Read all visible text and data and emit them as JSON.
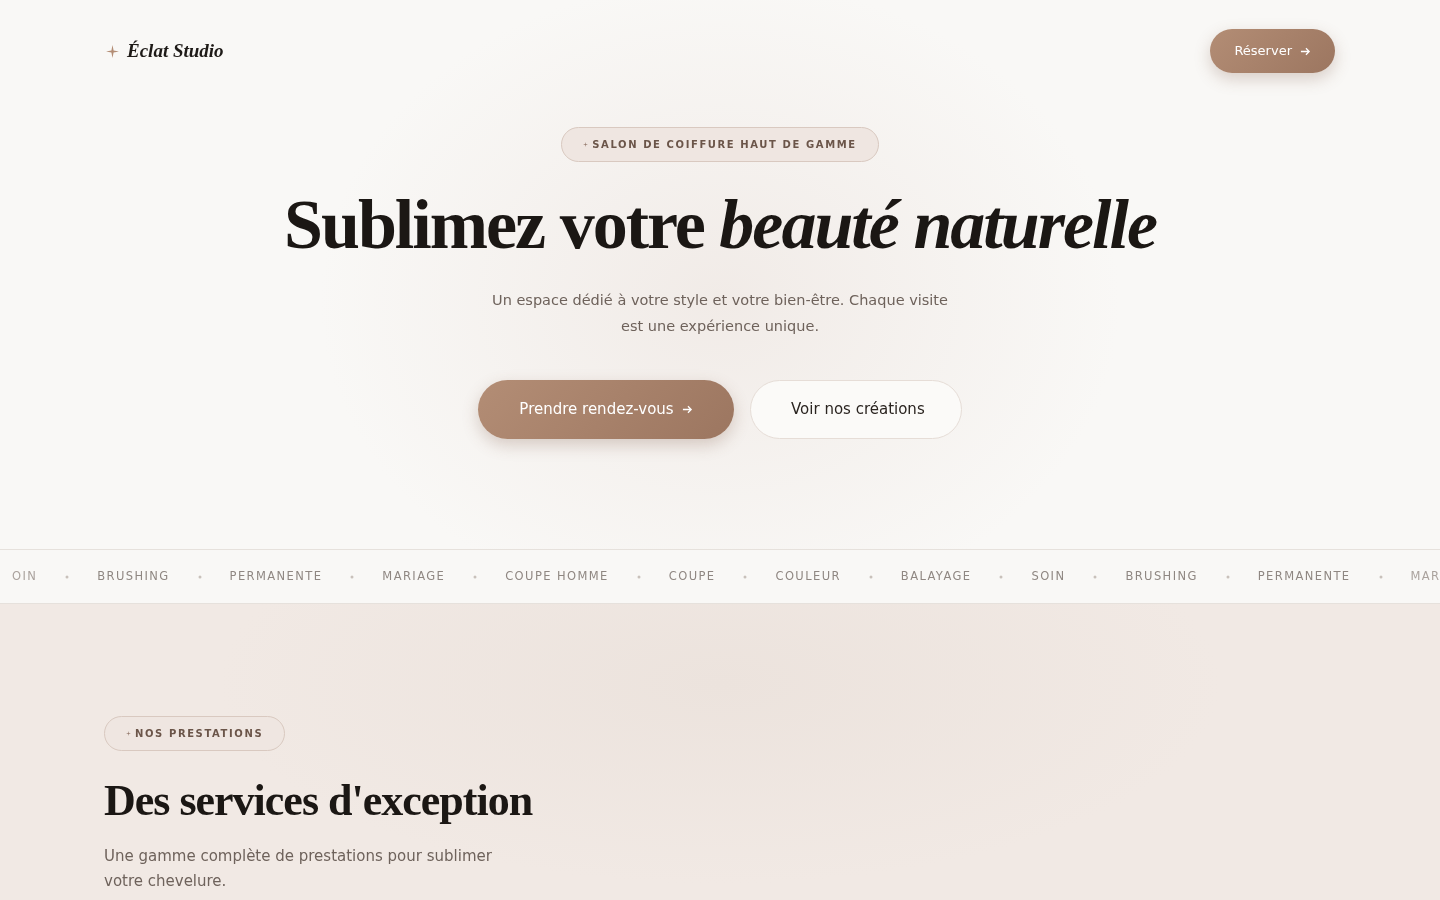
{
  "nav": {
    "brand": "Éclat Studio",
    "cta": "Réserver"
  },
  "hero": {
    "badge": "SALON DE COIFFURE HAUT DE GAMME",
    "title": "Sublimez votre *beauté naturelle*",
    "subtitle": "Un espace dédié à votre style et votre bien-être. Chaque visite est une expérience unique.",
    "primary": "Prendre rendez-vous",
    "secondary": "Voir nos créations"
  },
  "marquee": [
    {
      "label": "OIN",
      "faded": true
    },
    {
      "label": "BRUSHING",
      "faded": false
    },
    {
      "label": "PERMANENTE",
      "faded": false
    },
    {
      "label": "MARIAGE",
      "faded": false
    },
    {
      "label": "COUPE HOMME",
      "faded": false
    },
    {
      "label": "COUPE",
      "faded": false
    },
    {
      "label": "COULEUR",
      "faded": false
    },
    {
      "label": "BALAYAGE",
      "faded": false
    },
    {
      "label": "SOIN",
      "faded": false
    },
    {
      "label": "BRUSHING",
      "faded": false
    },
    {
      "label": "PERMANENTE",
      "faded": false
    },
    {
      "label": "MAR",
      "faded": true
    }
  ],
  "services": {
    "badge": "NOS PRESTATIONS",
    "title": "Des services d'exception",
    "text": "Une gamme complète de prestations pour sublimer votre chevelure."
  }
}
